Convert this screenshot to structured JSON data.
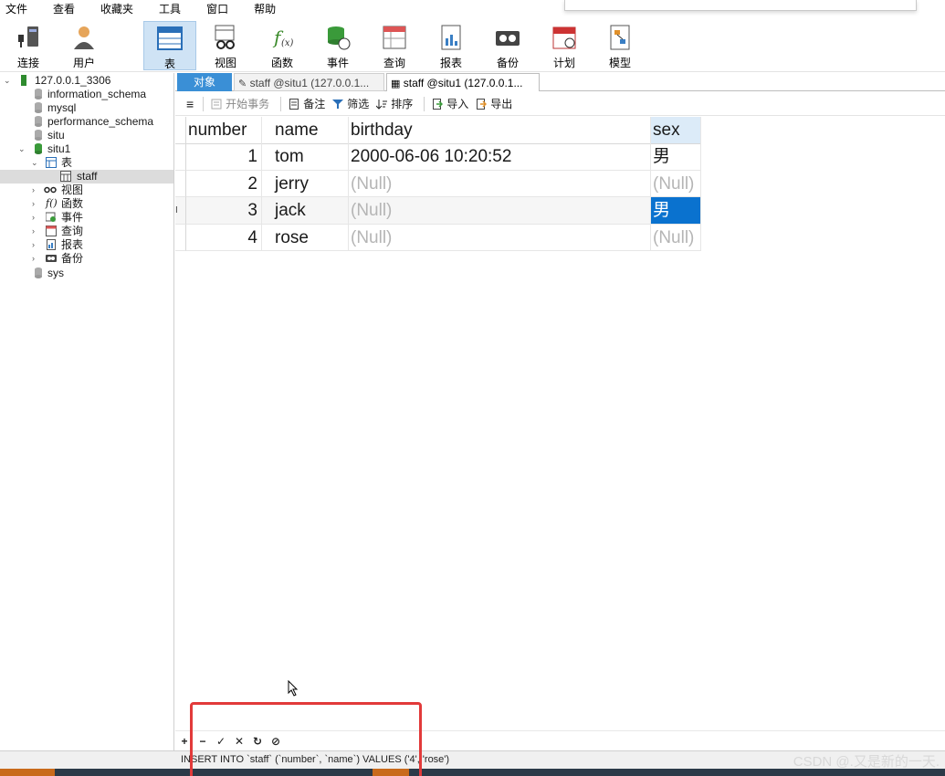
{
  "menu": [
    "文件",
    "查看",
    "收藏夹",
    "工具",
    "窗口",
    "帮助"
  ],
  "toolbar": [
    {
      "label": "连接",
      "icon": "connection-icon"
    },
    {
      "label": "用户",
      "icon": "user-icon"
    },
    {
      "label": "表",
      "icon": "table-icon",
      "active": true
    },
    {
      "label": "视图",
      "icon": "view-icon"
    },
    {
      "label": "函数",
      "icon": "function-icon"
    },
    {
      "label": "事件",
      "icon": "event-icon"
    },
    {
      "label": "查询",
      "icon": "query-icon"
    },
    {
      "label": "报表",
      "icon": "report-icon"
    },
    {
      "label": "备份",
      "icon": "backup-icon"
    },
    {
      "label": "计划",
      "icon": "schedule-icon"
    },
    {
      "label": "模型",
      "icon": "model-icon"
    }
  ],
  "navigator": {
    "connection": "127.0.0.1_3306",
    "databases": {
      "information_schema": "information_schema",
      "mysql": "mysql",
      "performance_schema": "performance_schema",
      "situ": "situ",
      "situ1": "situ1",
      "sys": "sys"
    },
    "situ1_children": {
      "tables": "表",
      "staff": "staff",
      "views": "视图",
      "functions": "函数",
      "events": "事件",
      "queries": "查询",
      "reports": "报表",
      "backups": "备份"
    }
  },
  "tabs": {
    "objects": "对象",
    "query": "staff @situ1 (127.0.0.1...",
    "table": "staff @situ1 (127.0.0.1..."
  },
  "subtoolbar": {
    "menu": "≡",
    "begin_transaction": "开始事务",
    "memo": "备注",
    "filter": "筛选",
    "sort": "排序",
    "import": "导入",
    "export": "导出"
  },
  "grid": {
    "columns": {
      "number": "number",
      "name": "name",
      "birthday": "birthday",
      "sex": "sex"
    },
    "rows": [
      {
        "number": "1",
        "name": "tom",
        "birthday": "2000-06-06 10:20:52",
        "sex": "男"
      },
      {
        "number": "2",
        "name": "jerry",
        "birthday": "(Null)",
        "sex": "(Null)"
      },
      {
        "number": "3",
        "name": "jack",
        "birthday": "(Null)",
        "sex": "男",
        "marker": "I"
      },
      {
        "number": "4",
        "name": "rose",
        "birthday": "(Null)",
        "sex": "(Null)"
      }
    ]
  },
  "bottom_toolbar": {
    "add": "+",
    "remove": "−",
    "apply": "✓",
    "discard": "✕",
    "refresh": "↻",
    "stop": "⊘"
  },
  "status": {
    "sql": "INSERT INTO `staff` (`number`, `name`) VALUES ('4', 'rose')",
    "watermark": "CSDN @.又是新的一天."
  },
  "colors": {
    "accent": "#3a8fd6",
    "selection": "#0a72cf",
    "highlight": "#e23a3a"
  }
}
